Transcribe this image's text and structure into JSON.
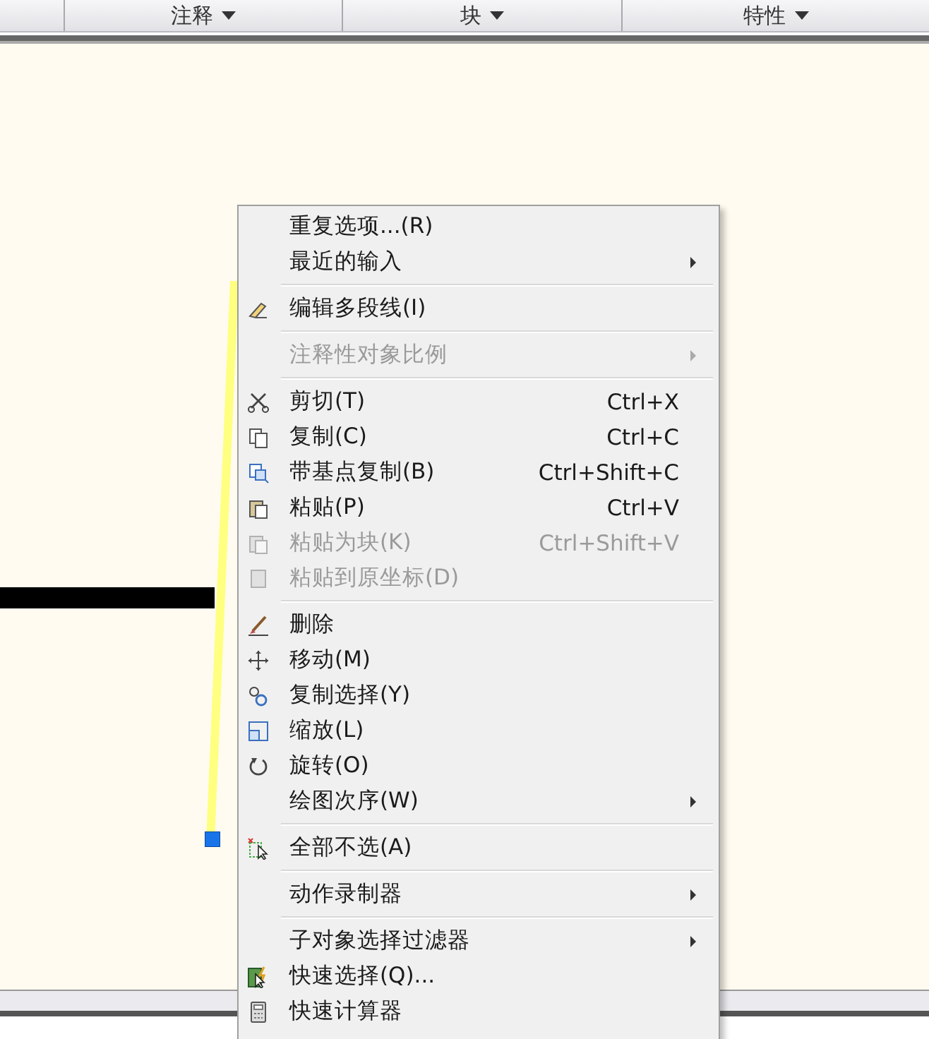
{
  "ribbon_panels": [
    {
      "label": "注释"
    },
    {
      "label": "块"
    },
    {
      "label": "特性"
    }
  ],
  "context_menu": {
    "sections": [
      [
        {
          "label": "重复选项...(R)",
          "disabled": false,
          "submenu": false
        },
        {
          "label": "最近的输入",
          "disabled": false,
          "submenu": true
        }
      ],
      [
        {
          "label": "编辑多段线(I)",
          "disabled": false,
          "submenu": false
        }
      ],
      [
        {
          "label": "注释性对象比例",
          "disabled": true,
          "submenu": true
        }
      ],
      [
        {
          "label": "剪切(T)",
          "shortcut": "Ctrl+X",
          "disabled": false,
          "submenu": false
        },
        {
          "label": "复制(C)",
          "shortcut": "Ctrl+C",
          "disabled": false,
          "submenu": false
        },
        {
          "label": "带基点复制(B)",
          "shortcut": "Ctrl+Shift+C",
          "disabled": false,
          "submenu": false
        },
        {
          "label": "粘贴(P)",
          "shortcut": "Ctrl+V",
          "disabled": false,
          "submenu": false
        },
        {
          "label": "粘贴为块(K)",
          "shortcut": "Ctrl+Shift+V",
          "disabled": true,
          "submenu": false
        },
        {
          "label": "粘贴到原坐标(D)",
          "disabled": true,
          "submenu": false
        }
      ],
      [
        {
          "label": "删除",
          "disabled": false,
          "submenu": false
        },
        {
          "label": "移动(M)",
          "disabled": false,
          "submenu": false
        },
        {
          "label": "复制选择(Y)",
          "disabled": false,
          "submenu": false
        },
        {
          "label": "缩放(L)",
          "disabled": false,
          "submenu": false
        },
        {
          "label": "旋转(O)",
          "disabled": false,
          "submenu": false
        },
        {
          "label": "绘图次序(W)",
          "disabled": false,
          "submenu": true
        }
      ],
      [
        {
          "label": "全部不选(A)",
          "disabled": false,
          "submenu": false
        }
      ],
      [
        {
          "label": "动作录制器",
          "disabled": false,
          "submenu": true
        }
      ],
      [
        {
          "label": "子对象选择过滤器",
          "disabled": false,
          "submenu": true
        },
        {
          "label": "快速选择(Q)...",
          "disabled": false,
          "submenu": false
        },
        {
          "label": "快速计算器",
          "disabled": false,
          "submenu": false
        }
      ]
    ]
  }
}
